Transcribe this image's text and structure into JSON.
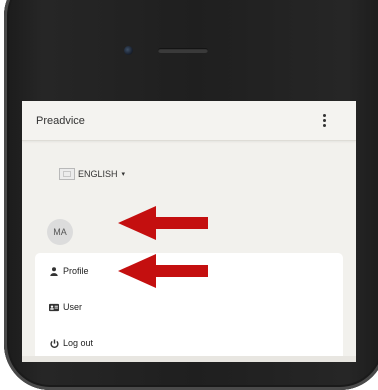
{
  "app": {
    "title": "Preadvice"
  },
  "header": {
    "menu_icon": "more-vert-icon"
  },
  "language": {
    "label": "ENGLISH",
    "flag_icon": "flag-icon",
    "caret": "▾"
  },
  "user": {
    "initials": "MA"
  },
  "menu": {
    "items": [
      {
        "label": "Profile",
        "icon": "person-icon"
      },
      {
        "label": "User",
        "icon": "id-card-icon"
      },
      {
        "label": "Log out",
        "icon": "power-icon"
      }
    ]
  },
  "colors": {
    "screen_bg": "#f2f1ed",
    "arrow": "#c40f0f",
    "phone_body": "#222222"
  }
}
